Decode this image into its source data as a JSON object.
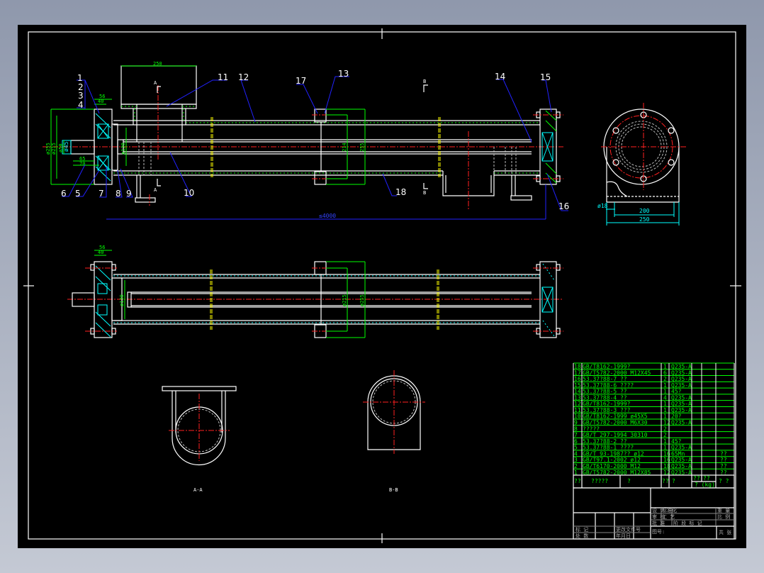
{
  "drawing": {
    "colors": {
      "background": "#000000",
      "outline": "#ffffff",
      "dimension": "#00ff00",
      "centerline": "#ff2020",
      "leader": "#2222ff",
      "hatch": "#00ffff"
    },
    "balloons": [
      "1",
      "2",
      "3",
      "4",
      "5",
      "6",
      "7",
      "8",
      "9",
      "10",
      "11",
      "12",
      "13",
      "14",
      "15",
      "16",
      "17",
      "18"
    ],
    "section_marks": {
      "a": "A",
      "b": "B"
    },
    "section_titles": {
      "aa": "A-A",
      "bb": "B-B"
    },
    "dims": {
      "inlet_width": "250",
      "flange_56": "56",
      "flange_40": "40",
      "d255": "ø255",
      "d215": "ø215",
      "d50": "ø50",
      "d45": "ø45",
      "len65": "65",
      "len70": "70",
      "d130": "ø130",
      "d214": "214",
      "d255b": "255",
      "total_length": "≤4000",
      "hole": "ø18",
      "base200": "200",
      "base250": "250",
      "lower_56": "56",
      "lower_40": "40",
      "lower_d130": "ø130",
      "lower_d215": "ø215",
      "lower_d255": "ø255"
    }
  },
  "parts_list": {
    "rows": [
      {
        "no": "18",
        "code": "GB/T8162-1999?",
        "qty": "1",
        "material": "Q235-A",
        "note": ""
      },
      {
        "no": "17",
        "code": "GB/T5782-2000 M12X45",
        "qty": "6",
        "material": "Q235-A",
        "note": ""
      },
      {
        "no": "16",
        "code": "53.37?88-7 ??",
        "qty": "2",
        "material": "Q235-A",
        "note": ""
      },
      {
        "no": "15",
        "code": "53.37?88-6 ????",
        "qty": "1",
        "material": "Q235-A",
        "note": ""
      },
      {
        "no": "14",
        "code": "53.37?88-5 ??",
        "qty": "1",
        "material": "45?",
        "note": ""
      },
      {
        "no": "13",
        "code": "53.37?88-4 ??",
        "qty": "4",
        "material": "Q235-A",
        "note": ""
      },
      {
        "no": "12",
        "code": "GB/T8162-1999?",
        "qty": "1",
        "material": "Q235-A",
        "note": ""
      },
      {
        "no": "11",
        "code": "53.37?88-3 ???",
        "qty": "1",
        "material": "Q235-A",
        "note": ""
      },
      {
        "no": "10",
        "code": "GB/T8162-1999 ø45X5",
        "qty": "1",
        "material": "20?",
        "note": ""
      },
      {
        "no": "9",
        "code": "GB/T5782-2000 M6X30",
        "qty": "12",
        "material": "Q235-A",
        "note": ""
      },
      {
        "no": "8",
        "code": "?????",
        "qty": "2",
        "material": "",
        "note": ""
      },
      {
        "no": "7",
        "code": "GB/T 297-1994 30310",
        "qty": "2",
        "material": "",
        "note": ""
      },
      {
        "no": "6",
        "code": "53.37?88-2 ??",
        "qty": "1",
        "material": "45?",
        "note": ""
      },
      {
        "no": "5",
        "code": "53.37?88-1 ????",
        "qty": "1",
        "material": "Q235-A",
        "note": ""
      },
      {
        "no": "4",
        "code": "GB/T 93-1987?? ø12",
        "qty": "16",
        "material": "65Mn",
        "note": "??"
      },
      {
        "no": "3",
        "code": "GB/T97.1-2002 ø12",
        "qty": "16",
        "material": "Q235-A",
        "note": "??"
      },
      {
        "no": "2",
        "code": "GB/T6170-2000 M12",
        "qty": "18",
        "material": "Q235-A",
        "note": "??"
      },
      {
        "no": "1",
        "code": "GB/T5782-2000 M12X85",
        "qty": "12",
        "material": "Q235-A",
        "note": "??"
      }
    ],
    "header": {
      "no": "??",
      "code": "?????",
      "name": "?",
      "qty": "??",
      "material": "?",
      "unit_weight": "??",
      "total_weight": "??",
      "weight_unit": "? (kg)",
      "note": "? ?"
    }
  },
  "title_block": {
    "cells": [
      "标 记",
      "处 数",
      "分 区",
      "更改文件号",
      "签 名",
      "年月日",
      "设 计",
      "标准化",
      "阶 段 标 记",
      "重 量",
      "比 例",
      "审 核",
      "工 艺",
      "批 准"
    ],
    "drawing_no_label": "图号:",
    "sheet": "共 张"
  }
}
